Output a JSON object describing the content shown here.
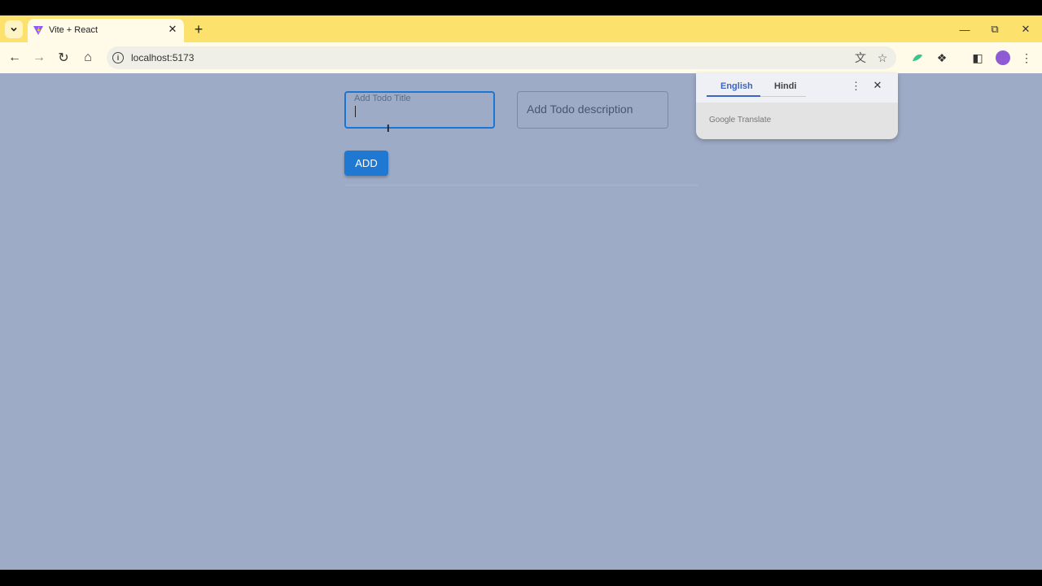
{
  "browser": {
    "tab_title": "Vite + React",
    "url": "localhost:5173",
    "colors": {
      "tabstrip": "#fce16d",
      "toolbar": "#fffbe8",
      "viewport": "#9eabc6"
    }
  },
  "icons": {
    "tab_search": "⌄",
    "tab_close": "✕",
    "new_tab": "+",
    "minimize": "—",
    "restore": "⧉",
    "close_window": "✕",
    "back": "←",
    "forward": "→",
    "reload": "↻",
    "home": "⌂",
    "info": "i",
    "translate": "文",
    "star": "☆",
    "extensions": "❖",
    "side_panel": "◧",
    "menu": "⋮"
  },
  "app": {
    "title_label": "Add Todo Title",
    "description_placeholder": "Add Todo description",
    "add_label": "ADD",
    "accent": "#1f78d1"
  },
  "translate_popup": {
    "lang_source": "English",
    "lang_target": "Hindi",
    "menu_glyph": "⋮",
    "close_glyph": "✕",
    "brand": "Google Translate"
  }
}
